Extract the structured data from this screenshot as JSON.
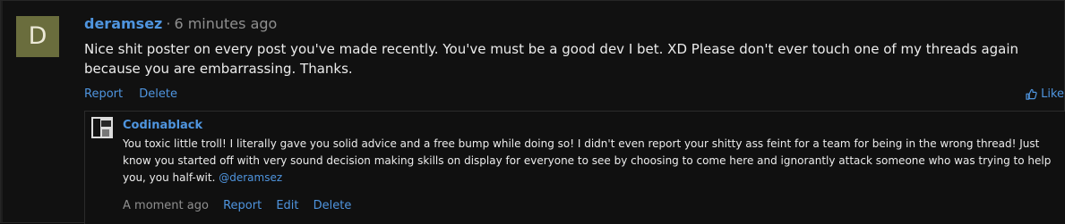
{
  "post": {
    "avatar_initial": "D",
    "username": "deramsez",
    "separator": "·",
    "time": "6 minutes ago",
    "text": "Nice shit poster on every post you've made recently. You've must be a good dev I bet. XD Please don't ever touch one of my threads again because you are embarrassing. Thanks.",
    "actions": {
      "report": "Report",
      "delete": "Delete",
      "like": "Like"
    }
  },
  "reply": {
    "username": "Codinablack",
    "text": "You toxic little troll! I literally gave you solid advice and a free bump while doing so! I didn't even report your shitty ass feint for a team for being in the wrong thread! Just know you started off with very sound decision making skills on display for everyone to see by choosing to come here and ignorantly attack someone who was trying to help you, you half-wit.",
    "mention": "@deramsez",
    "time": "A moment ago",
    "actions": {
      "report": "Report",
      "edit": "Edit",
      "delete": "Delete"
    }
  },
  "colors": {
    "background": "#111111",
    "accent": "#4f95df",
    "text": "#ececec",
    "muted": "#8f8f8f",
    "avatar": "#6a6d3d"
  },
  "icons": {
    "like": "thumbs-up-icon"
  }
}
